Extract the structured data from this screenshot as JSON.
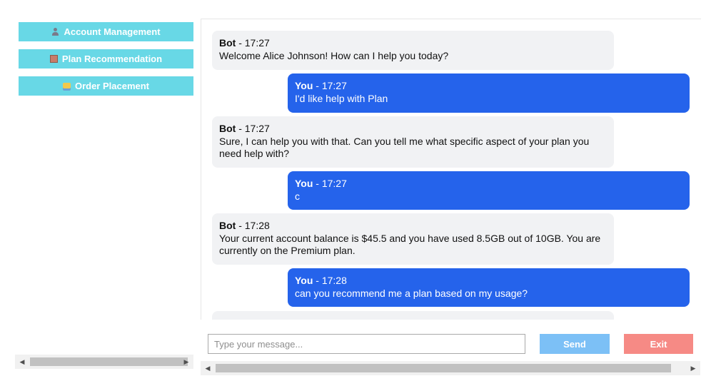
{
  "sidebar": {
    "items": [
      {
        "label": "Account Management",
        "icon": "user-icon"
      },
      {
        "label": "Plan Recommendation",
        "icon": "calculator-icon"
      },
      {
        "label": "Order Placement",
        "icon": "shopping-bag-icon"
      }
    ]
  },
  "chat": {
    "messages": [
      {
        "sender": "Bot",
        "time": " - 17:27",
        "text": "Welcome Alice Johnson! How can I help you today?"
      },
      {
        "sender": "You",
        "time": " - 17:27",
        "text": "I'd like help with Plan"
      },
      {
        "sender": "Bot",
        "time": " - 17:27",
        "text": "Sure, I can help you with that. Can you tell me what specific aspect of your plan you need help with?"
      },
      {
        "sender": "You",
        "time": " - 17:27",
        "text": "c"
      },
      {
        "sender": "Bot",
        "time": " - 17:28",
        "text": "Your current account balance is $45.5 and you have used 8.5GB out of 10GB. You are currently on the Premium plan."
      },
      {
        "sender": "You",
        "time": " - 17:28",
        "text": "can you recommend me a plan based on my usage?"
      }
    ]
  },
  "input": {
    "placeholder": "Type your message...",
    "value": ""
  },
  "buttons": {
    "send_label": "Send",
    "exit_label": "Exit"
  },
  "colors": {
    "nav_button": "#68d8e6",
    "user_bubble": "#2563eb",
    "bot_bubble": "#f1f2f4",
    "send": "#7cc0f6",
    "exit": "#f68a85"
  }
}
